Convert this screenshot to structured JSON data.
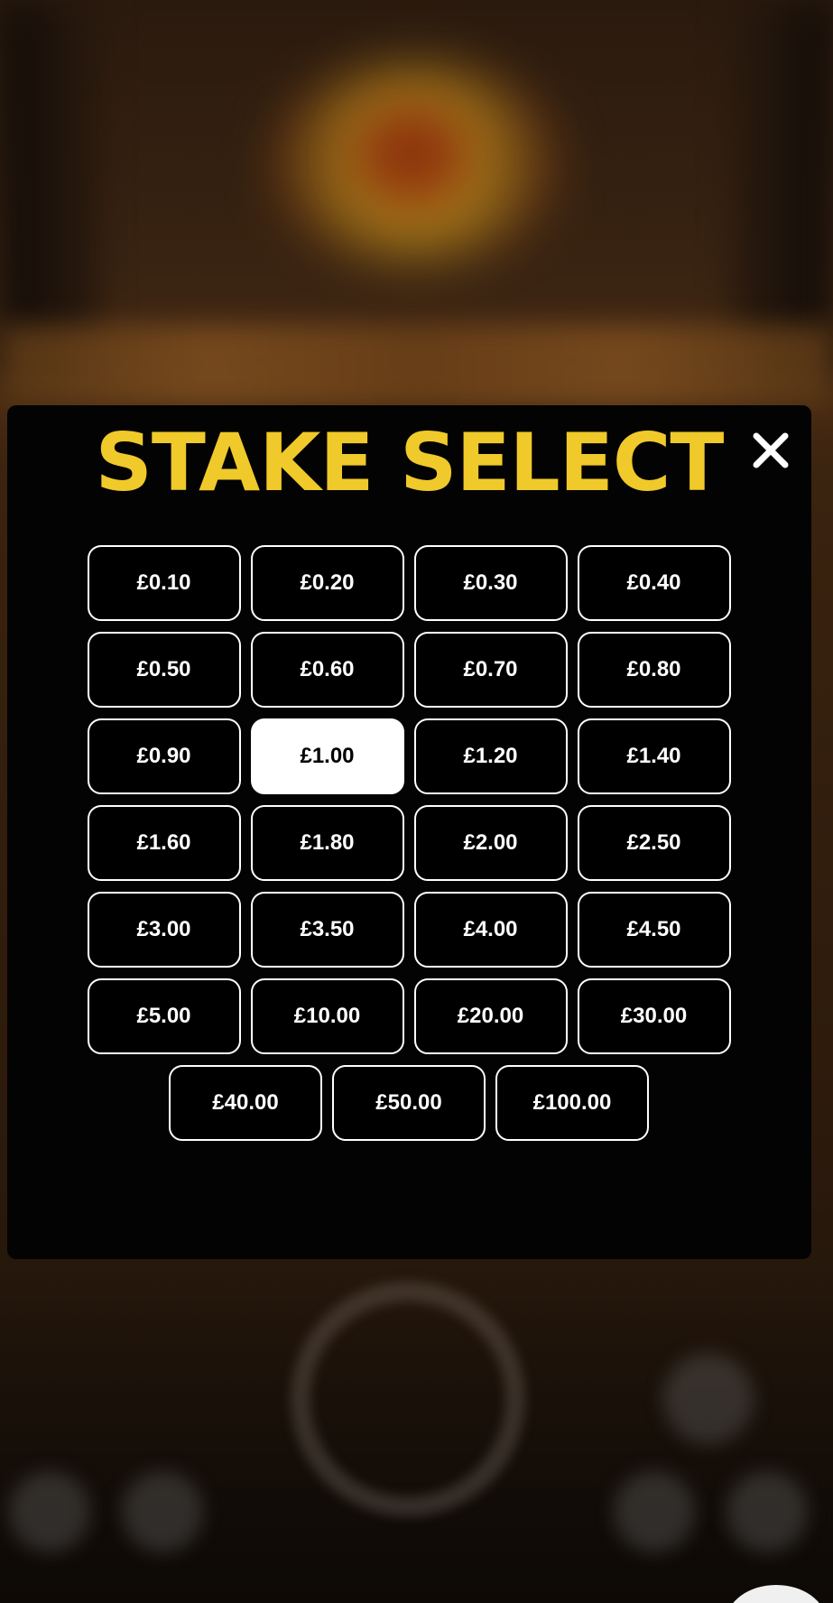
{
  "modal": {
    "title": "STAKE SELECT",
    "close_icon": "close-icon",
    "title_color": "#f0c92a",
    "background_color": "#030303"
  },
  "stakes": [
    {
      "label": "£0.10",
      "selected": false
    },
    {
      "label": "£0.20",
      "selected": false
    },
    {
      "label": "£0.30",
      "selected": false
    },
    {
      "label": "£0.40",
      "selected": false
    },
    {
      "label": "£0.50",
      "selected": false
    },
    {
      "label": "£0.60",
      "selected": false
    },
    {
      "label": "£0.70",
      "selected": false
    },
    {
      "label": "£0.80",
      "selected": false
    },
    {
      "label": "£0.90",
      "selected": false
    },
    {
      "label": "£1.00",
      "selected": true
    },
    {
      "label": "£1.20",
      "selected": false
    },
    {
      "label": "£1.40",
      "selected": false
    },
    {
      "label": "£1.60",
      "selected": false
    },
    {
      "label": "£1.80",
      "selected": false
    },
    {
      "label": "£2.00",
      "selected": false
    },
    {
      "label": "£2.50",
      "selected": false
    },
    {
      "label": "£3.00",
      "selected": false
    },
    {
      "label": "£3.50",
      "selected": false
    },
    {
      "label": "£4.00",
      "selected": false
    },
    {
      "label": "£4.50",
      "selected": false
    },
    {
      "label": "£5.00",
      "selected": false
    },
    {
      "label": "£10.00",
      "selected": false
    },
    {
      "label": "£20.00",
      "selected": false
    },
    {
      "label": "£30.00",
      "selected": false
    },
    {
      "label": "£40.00",
      "selected": false
    },
    {
      "label": "£50.00",
      "selected": false
    },
    {
      "label": "£100.00",
      "selected": false
    }
  ]
}
